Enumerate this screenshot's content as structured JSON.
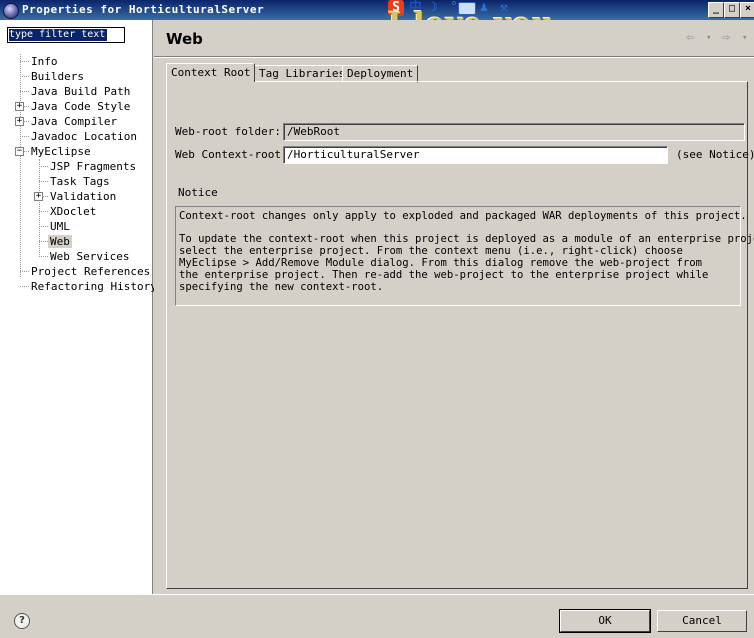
{
  "window": {
    "title": "Properties for HorticulturalServer",
    "overlay_text": "I love you",
    "ime_logo": "S",
    "ime_mode": "中"
  },
  "filter": {
    "placeholder": "type filter text"
  },
  "tree": [
    {
      "label": "Info"
    },
    {
      "label": "Builders"
    },
    {
      "label": "Java Build Path"
    },
    {
      "label": "Java Code Style"
    },
    {
      "label": "Java Compiler"
    },
    {
      "label": "Javadoc Location"
    },
    {
      "label": "MyEclipse"
    },
    {
      "label": "JSP Fragments"
    },
    {
      "label": "Task Tags"
    },
    {
      "label": "Validation"
    },
    {
      "label": "XDoclet"
    },
    {
      "label": "UML"
    },
    {
      "label": "Web",
      "selected": true
    },
    {
      "label": "Web Services"
    },
    {
      "label": "Project References"
    },
    {
      "label": "Refactoring History"
    }
  ],
  "page": {
    "title": "Web"
  },
  "tabs": [
    {
      "label": "Context Root",
      "active": true
    },
    {
      "label": "Tag Libraries"
    },
    {
      "label": "Deployment"
    }
  ],
  "fields": {
    "web_root_label": "Web-root folder:",
    "web_root_value": "/WebRoot",
    "context_root_label": "Web Context-root:",
    "context_root_value": "/HorticulturalServer",
    "see_notice": "(see Notice)"
  },
  "notice": {
    "legend": "Notice",
    "line1": "Context-root changes only apply to exploded and packaged WAR deployments of this project.",
    "line2": "To update the context-root when this project is deployed as a module of an enterprise project",
    "line3": "select the enterprise project. From the context menu (i.e., right-click) choose",
    "line4": "MyEclipse > Add/Remove Module dialog. From this dialog remove the web-project from",
    "line5": "the enterprise project. Then re-add the web-project to the enterprise project while",
    "line6": "specifying the new context-root."
  },
  "buttons": {
    "ok": "OK",
    "cancel": "Cancel",
    "help": "?"
  },
  "colors": {
    "title_bar": "#0a246a",
    "selection": "#0a246a",
    "dialog_bg": "#d4d0c8"
  }
}
